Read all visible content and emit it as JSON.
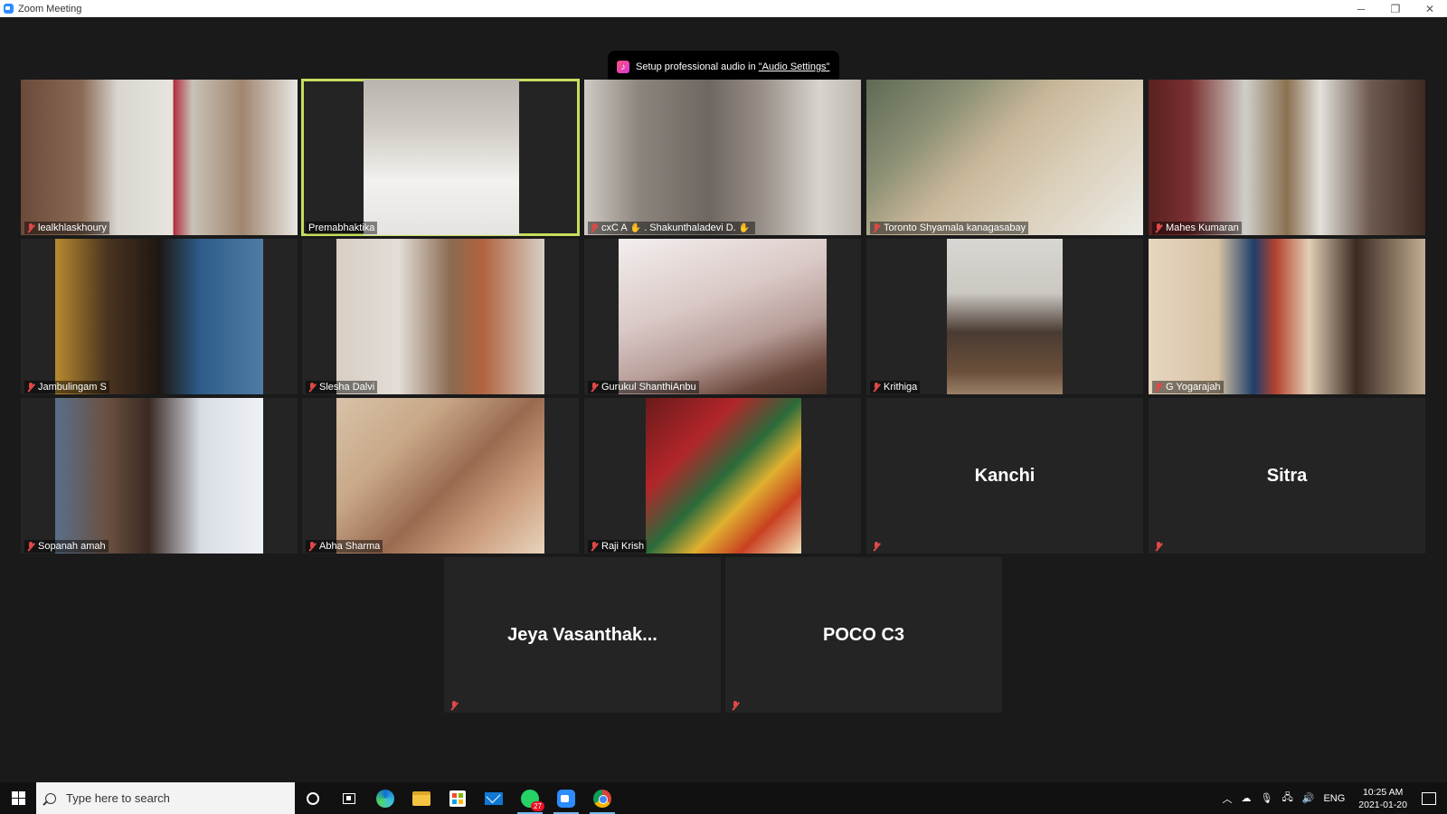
{
  "window": {
    "title": "Zoom Meeting"
  },
  "window_controls": {
    "minimize": "─",
    "restore": "❐",
    "close": "✕"
  },
  "notice": {
    "text": "Setup professional audio in ",
    "link": "\"Audio Settings\""
  },
  "participants": [
    {
      "name": "lealkhlaskhoury",
      "muted": true
    },
    {
      "name": "Premabhaktika",
      "muted": false,
      "active_speaker": true
    },
    {
      "name_prefix": "cxC A",
      "name": ". Shakunthaladevi D.",
      "muted": true,
      "hand_raised": true
    },
    {
      "name": "Toronto  Shyamala  kanagasabay",
      "muted": true
    },
    {
      "name": "Mahes Kumaran",
      "muted": true
    },
    {
      "name": "Jambulingam S",
      "muted": true
    },
    {
      "name": "Slesha Dalvi",
      "muted": true
    },
    {
      "name": "Gurukul ShanthiAnbu",
      "muted": true
    },
    {
      "name": "Krithiga",
      "muted": true
    },
    {
      "name": "G Yogarajah",
      "muted": true
    },
    {
      "name": "Sopanah amah",
      "muted": true
    },
    {
      "name": "Abha Sharma",
      "muted": true
    },
    {
      "name": "Raji Krish",
      "muted": true
    },
    {
      "display": "Kanchi",
      "muted": true,
      "video": false
    },
    {
      "display": "Sitra",
      "muted": true,
      "video": false
    },
    {
      "display": "Jeya  Vasanthak...",
      "muted": true,
      "video": false
    },
    {
      "display": "POCO C3",
      "muted": true,
      "video": false
    }
  ],
  "taskbar": {
    "search_placeholder": "Type here to search",
    "whatsapp_badge": "27",
    "tray": {
      "language": "ENG",
      "time": "10:25 AM",
      "date": "2021-01-20"
    }
  },
  "colors": {
    "active_speaker": "#c6dd5d",
    "muted": "#e04848",
    "background": "#1a1a1a"
  }
}
